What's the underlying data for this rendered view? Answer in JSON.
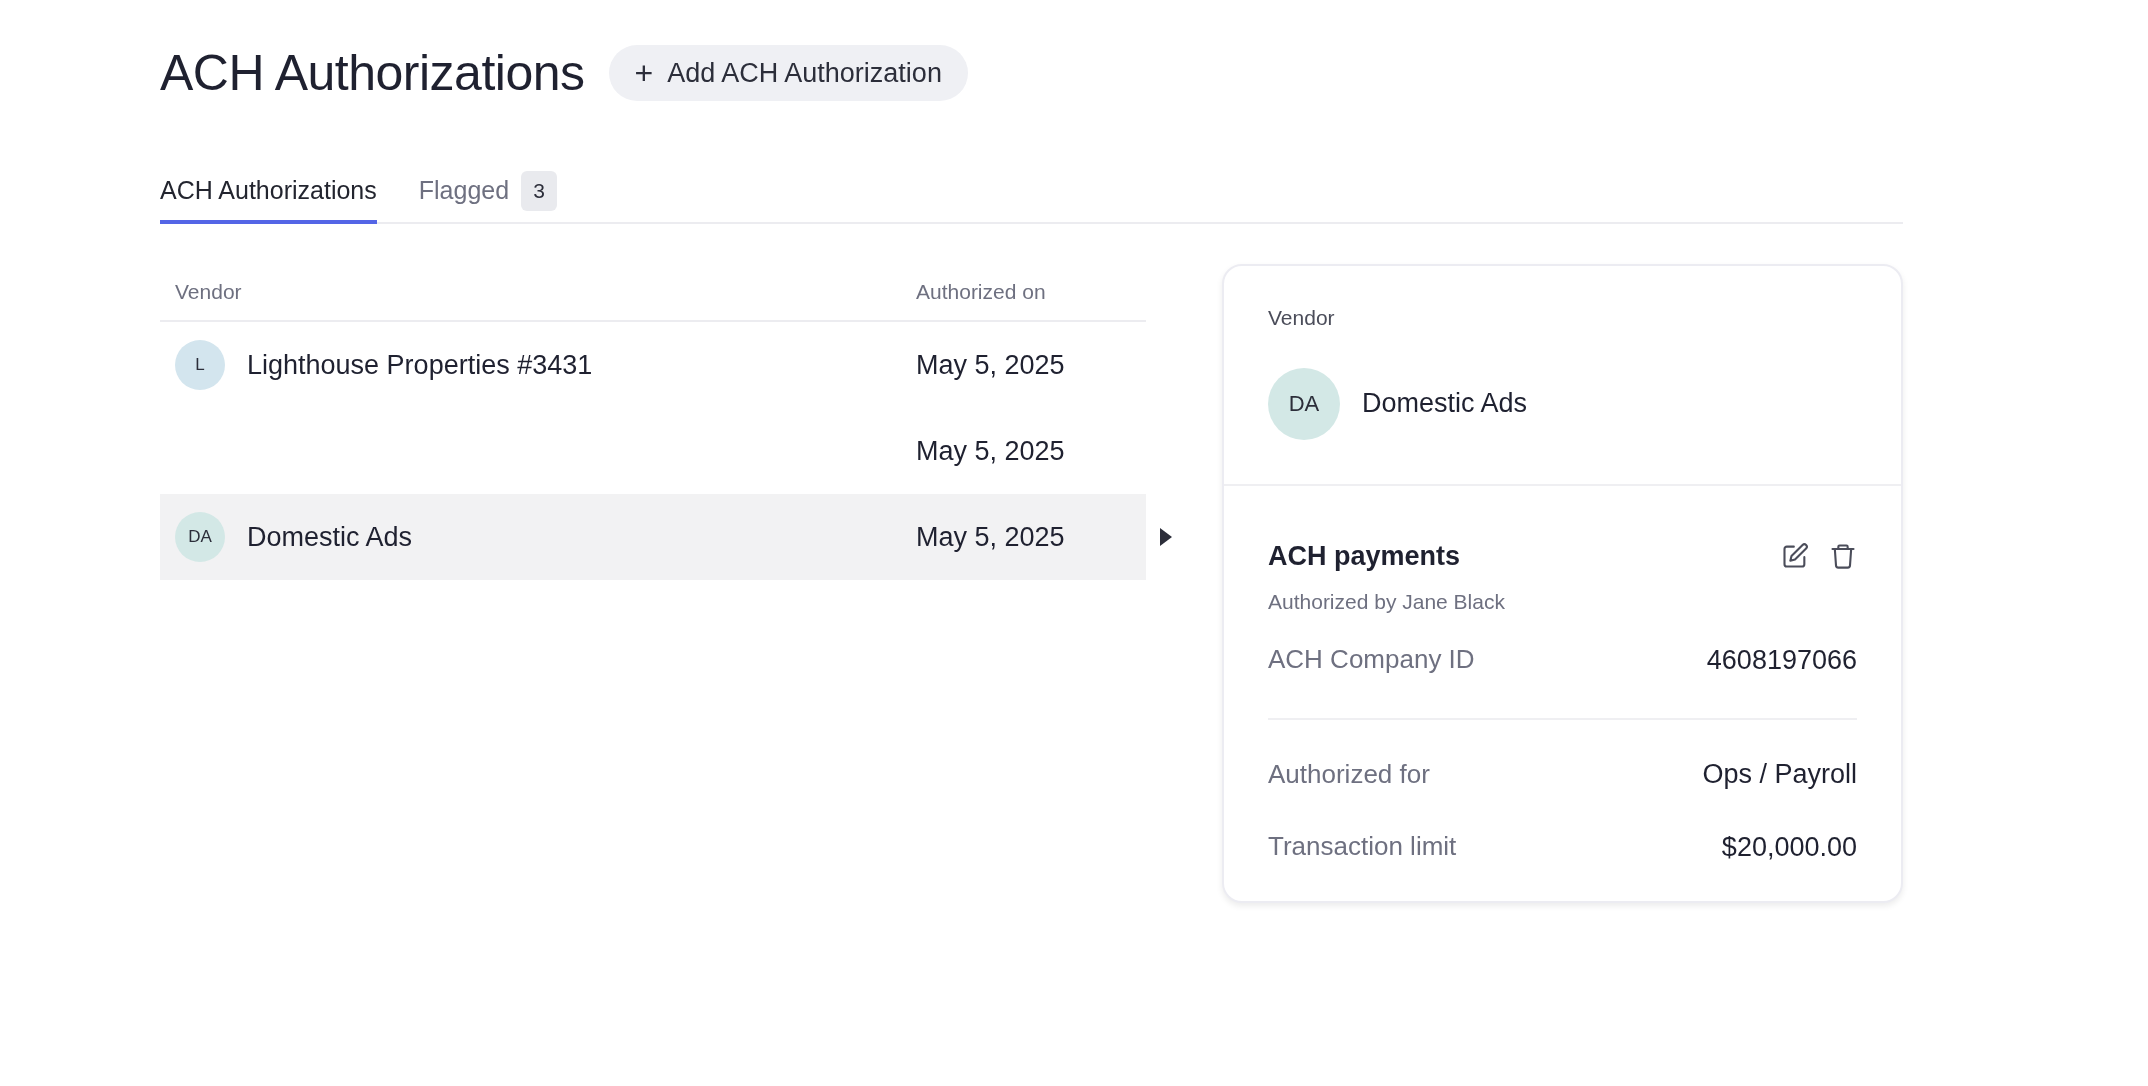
{
  "page": {
    "title": "ACH Authorizations",
    "add_button": {
      "icon": "+",
      "label": "Add ACH Authorization"
    }
  },
  "tabs": [
    {
      "label": "ACH Authorizations",
      "selected": true
    },
    {
      "label": "Flagged",
      "count": "3",
      "selected": false
    }
  ],
  "table": {
    "columns": [
      "Vendor",
      "Authorized on"
    ],
    "rows": [
      {
        "vendor": {
          "initials": "L",
          "name": "Lighthouse Properties #3431",
          "color": "#d3e5ee"
        },
        "authorized_on": "May 5, 2025",
        "selected": false
      },
      {
        "authorized_on": "May 5, 2025",
        "selected": false
      },
      {
        "vendor": {
          "initials": "DA",
          "name": "Domestic Ads",
          "color": "#d3e8e6"
        },
        "authorized_on": "May 5, 2025",
        "selected": true
      }
    ]
  },
  "detail": {
    "vendor_label": "Vendor",
    "vendor": {
      "initials": "DA",
      "name": "Domestic Ads",
      "color": "#d3e8e6"
    },
    "section_title": "ACH payments",
    "authorized_by": "Authorized by Jane Black",
    "company_id": {
      "label": "ACH Company ID",
      "value": "4608197066"
    },
    "fields": [
      {
        "label": "Authorized for",
        "value": "Ops / Payroll"
      },
      {
        "label": "Transaction limit",
        "value": "$20,000.00"
      }
    ]
  }
}
